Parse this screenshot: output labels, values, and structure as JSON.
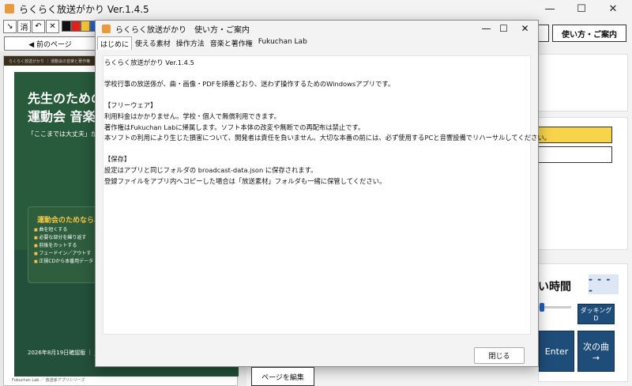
{
  "main_window": {
    "title": "らくらく放送がかり Ver.1.4.5",
    "controls": {
      "minimize": "—",
      "maximize": "☐",
      "close": "✕"
    }
  },
  "toolbar": {
    "pen": "↘",
    "eraser": "消",
    "undo": "↶",
    "clear": "✕",
    "colors": [
      "#111111",
      "#e0201a",
      "#f4c430",
      "#1e5fd0"
    ]
  },
  "prev_page_label": "◀ 前のページ",
  "pdf_page": {
    "header": "らくらく放送がかり ｜ 運動会の音楽と著作権",
    "title_line1": "先生のための",
    "title_line2": "運動会 音楽著",
    "quote": "「ここまでは大丈夫」が、ひ",
    "card_title": "運動会のためなら、",
    "bullets": [
      "曲を短くする",
      "必要な部分を繰り返す",
      "前後をカットする",
      "フェードイン／アウトす",
      "正規CDから本番用データ"
    ],
    "date_line": "2026年8月19日確認版 ｜ JASRAC・",
    "footer": "Fukuchan Lab ／ 放送係アプリシリーズ"
  },
  "right_panel": {
    "help_button": "使い方・ご案内",
    "time_label": "い時間",
    "dash_indicator": "- - - -",
    "docking_label": "ダッキング\nD",
    "enter_label": "Enter",
    "next_song_label": "次の曲\n→",
    "edit_page_label": "ページを編集"
  },
  "dialog": {
    "title": "らくらく放送がかり　使い方・ご案内",
    "tabs": [
      "はじめに",
      "使える素材",
      "操作方法",
      "音楽と著作権",
      "Fukuchan Lab"
    ],
    "active_tab": 0,
    "lines": [
      "らくらく放送がかり Ver.1.4.5",
      "",
      "学校行事の放送係が、曲・画像・PDFを順番どおり、迷わず操作するためのWindowsアプリです。",
      "",
      "【フリーウェア】",
      "利用料金はかかりません。学校・個人で無償利用できます。",
      "著作権はFukuchan Labに帰属します。ソフト本体の改変や無断での再配布は禁止です。",
      "本ソフトの利用により生じた損害について、開発者は責任を負いません。大切な本番の前には、必ず使用するPCと音響設備でリハーサルしてください。",
      "",
      "【保存】",
      "設定はアプリと同じフォルダの broadcast-data.json に保存されます。",
      "登録ファイルをアプリ内へコピーした場合は「放送素材」フォルダも一緒に保管してください。"
    ],
    "close_label": "閉じる"
  }
}
